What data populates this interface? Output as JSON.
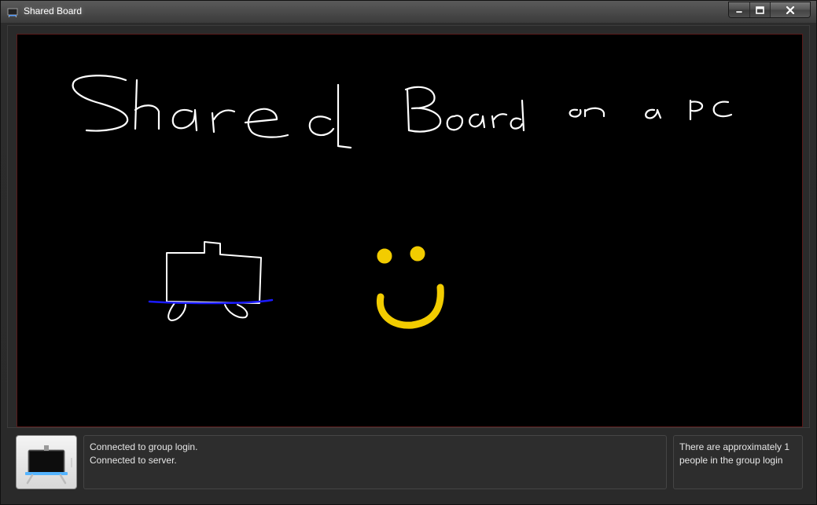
{
  "window": {
    "title": "Shared Board",
    "icon": "board-icon",
    "buttons": [
      "minimize-icon",
      "maximize-icon",
      "close-icon"
    ]
  },
  "board": {
    "background": "#000000",
    "border_color": "#5a1a1a",
    "handwriting_text": "Shared Board on a PC",
    "ink_colors": {
      "white": "#ffffff",
      "blue": "#1a1aff",
      "yellow": "#f2cc00"
    }
  },
  "logo": {
    "icon": "board-logo-icon"
  },
  "status": {
    "lines": [
      "Connected to group login.",
      "Connected to server."
    ]
  },
  "info": {
    "text": "There are approximately 1 people in the group login"
  }
}
